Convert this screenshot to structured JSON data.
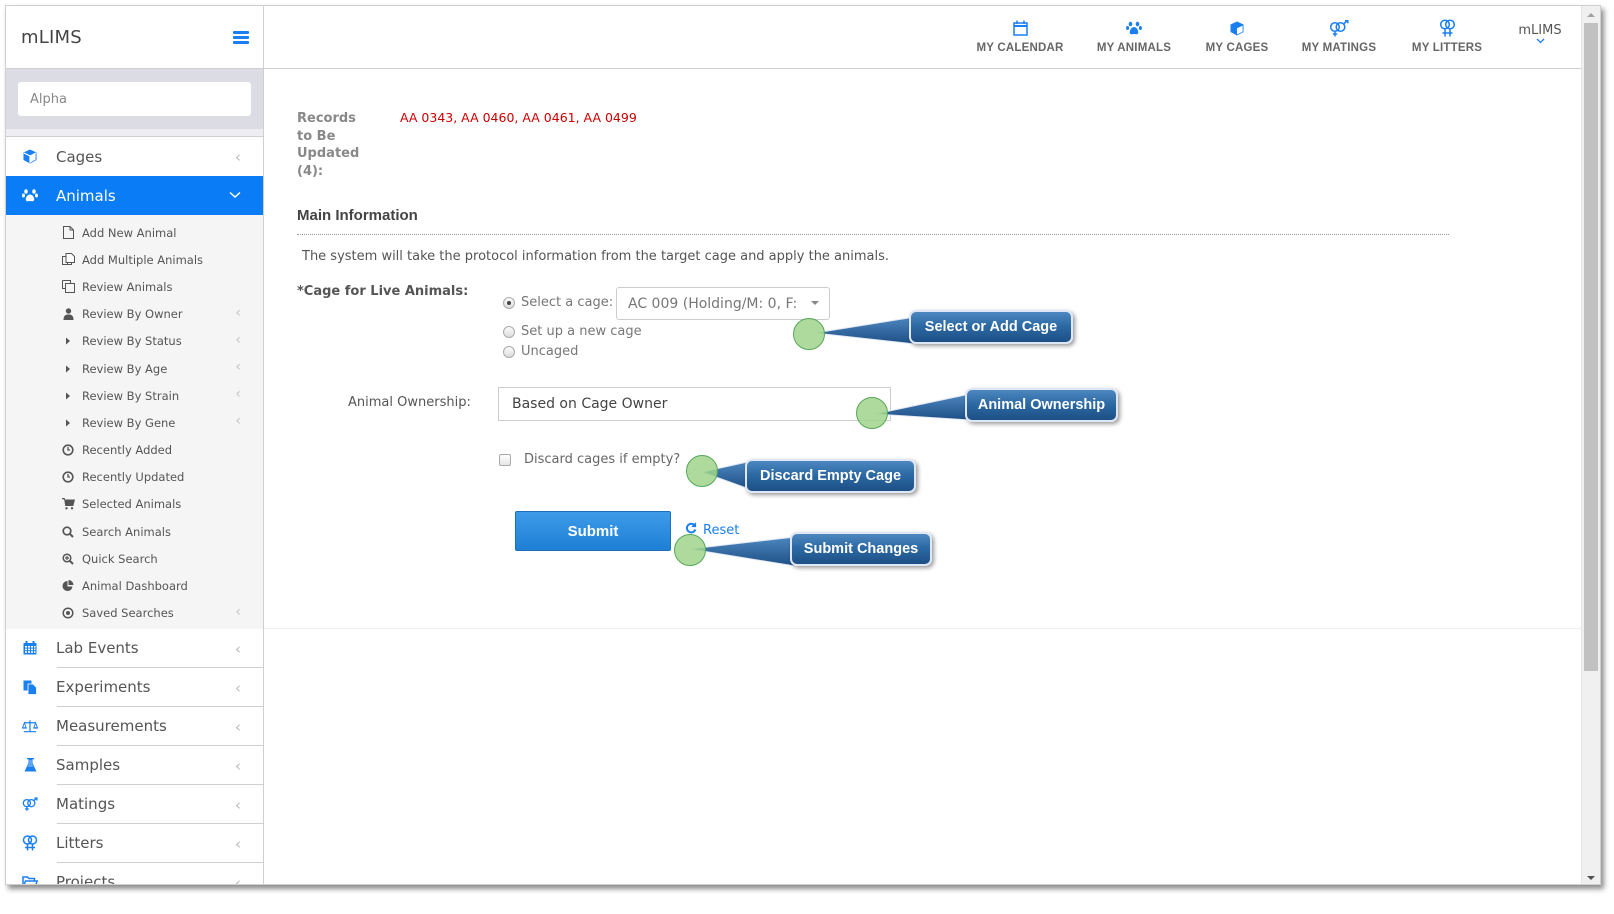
{
  "sidebar": {
    "brand": "mLIMS",
    "search_placeholder": "Alpha",
    "items": [
      {
        "key": "cages",
        "label": "Cages",
        "icon": "cube-icon"
      },
      {
        "key": "animals",
        "label": "Animals",
        "icon": "paw-icon",
        "active": true
      },
      {
        "key": "lab-events",
        "label": "Lab Events",
        "icon": "calendar-icon"
      },
      {
        "key": "experiments",
        "label": "Experiments",
        "icon": "copy-icon"
      },
      {
        "key": "measurements",
        "label": "Measurements",
        "icon": "balance-scale-icon"
      },
      {
        "key": "samples",
        "label": "Samples",
        "icon": "flask-icon"
      },
      {
        "key": "matings",
        "label": "Matings",
        "icon": "mars-venus-icon"
      },
      {
        "key": "litters",
        "label": "Litters",
        "icon": "venus-double-icon"
      },
      {
        "key": "projects",
        "label": "Projects",
        "icon": "folder-open-icon"
      }
    ],
    "animals_submenu": [
      {
        "label": "Add New Animal",
        "icon": "file-icon"
      },
      {
        "label": "Add Multiple Animals",
        "icon": "files-icon"
      },
      {
        "label": "Review Animals",
        "icon": "clone-icon"
      },
      {
        "label": "Review By Owner",
        "icon": "user-icon",
        "expandable": true
      },
      {
        "label": "Review By Status",
        "icon": "caret-right-icon",
        "expandable": true
      },
      {
        "label": "Review By Age",
        "icon": "caret-right-icon",
        "expandable": true
      },
      {
        "label": "Review By Strain",
        "icon": "caret-right-icon",
        "expandable": true
      },
      {
        "label": "Review By Gene",
        "icon": "caret-right-icon",
        "expandable": true
      },
      {
        "label": "Recently Added",
        "icon": "clock-icon"
      },
      {
        "label": "Recently Updated",
        "icon": "clock-icon"
      },
      {
        "label": "Selected Animals",
        "icon": "cart-icon"
      },
      {
        "label": "Search Animals",
        "icon": "search-icon"
      },
      {
        "label": "Quick Search",
        "icon": "zoom-in-icon"
      },
      {
        "label": "Animal Dashboard",
        "icon": "pie-chart-icon"
      },
      {
        "label": "Saved Searches",
        "icon": "dot-circle-icon",
        "expandable": true
      }
    ]
  },
  "topnav": {
    "items": [
      {
        "label": "MY CALENDAR",
        "icon": "calendar-icon"
      },
      {
        "label": "MY ANIMALS",
        "icon": "paw-icon"
      },
      {
        "label": "MY CAGES",
        "icon": "cube-icon"
      },
      {
        "label": "MY MATINGS",
        "icon": "mars-venus-icon"
      },
      {
        "label": "MY LITTERS",
        "icon": "venus-double-icon"
      }
    ],
    "user": "mLIMS"
  },
  "main": {
    "records_label": "Records to Be Updated (4):",
    "records_value": "AA 0343, AA 0460, AA 0461, AA 0499",
    "section_title": "Main Information",
    "info_text": "The system will take the protocol information from the target cage and apply the animals.",
    "cage_label": "*Cage for Live Animals:",
    "radio_options": [
      {
        "label": "Select a cage:",
        "checked": true
      },
      {
        "label": "Set up a new cage",
        "checked": false
      },
      {
        "label": "Uncaged",
        "checked": false
      }
    ],
    "cage_select_value": "AC 009 (Holding/M: 0, F:",
    "ownership_label": "Animal Ownership:",
    "ownership_value": "Based on Cage Owner",
    "discard_label": "Discard cages if empty?",
    "discard_checked": false,
    "submit_label": "Submit",
    "reset_label": "Reset"
  },
  "callouts": {
    "select_cage": "Select or Add Cage",
    "ownership": "Animal Ownership",
    "discard": "Discard Empty Cage",
    "submit": "Submit Changes"
  },
  "colors": {
    "accent": "#0a7cf5",
    "records_red": "#cc0000",
    "callout_blue": "#2d6aa4",
    "marker_green": "#a0d58c"
  }
}
